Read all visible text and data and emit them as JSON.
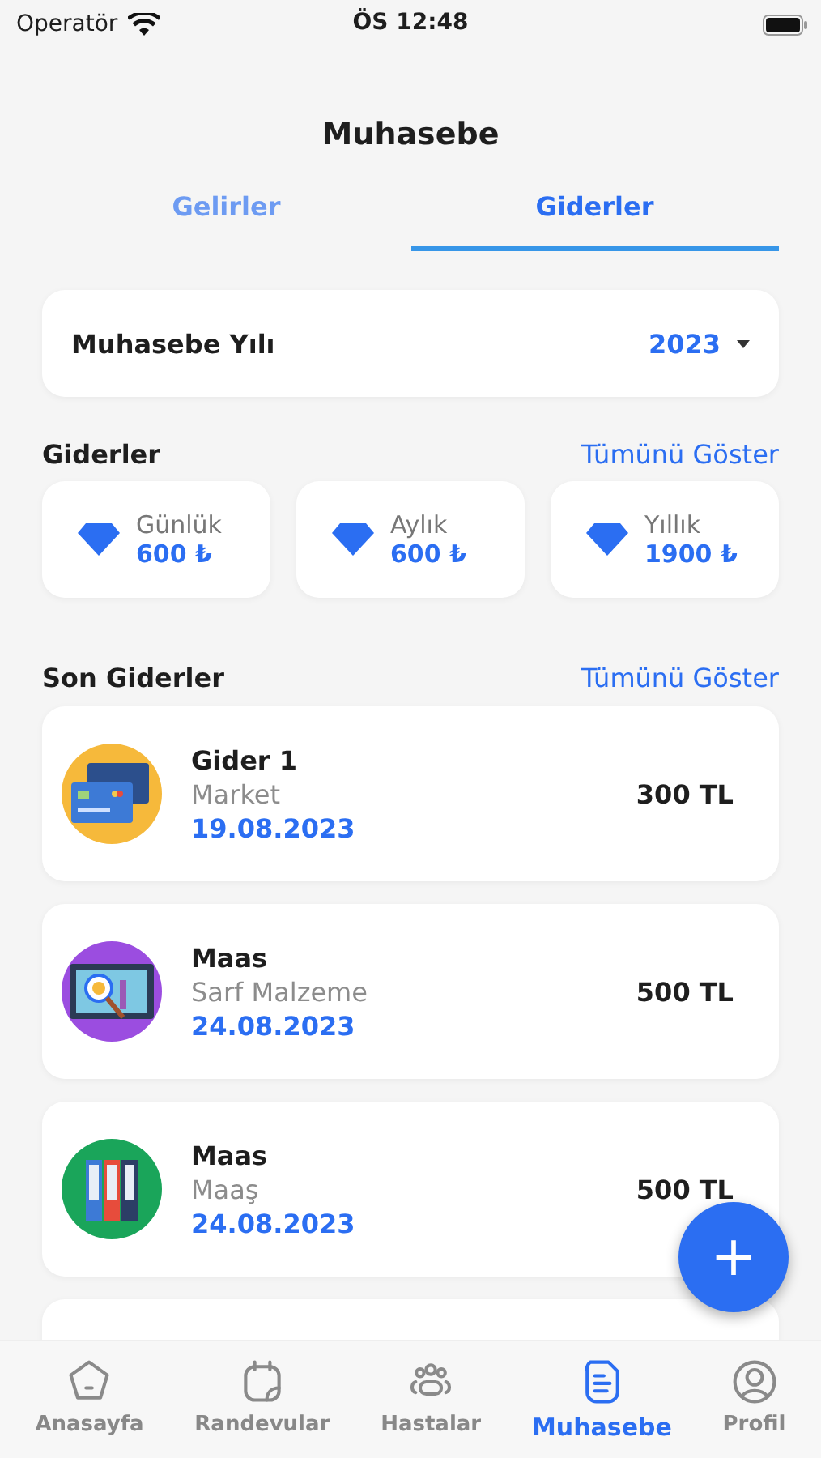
{
  "status_bar": {
    "carrier": "Operatör",
    "time": "ÖS 12:48"
  },
  "title": "Muhasebe",
  "tabs": [
    {
      "label": "Gelirler",
      "selected": false
    },
    {
      "label": "Giderler",
      "selected": true
    }
  ],
  "year_picker": {
    "label": "Muhasebe Yılı",
    "value": "2023"
  },
  "summary": {
    "title": "Giderler",
    "link": "Tümünü Göster",
    "stats": [
      {
        "label": "Günlük",
        "value": "600 ₺"
      },
      {
        "label": "Aylık",
        "value": "600 ₺"
      },
      {
        "label": "Yıllık",
        "value": "1900 ₺"
      }
    ]
  },
  "recent": {
    "title": "Son Giderler",
    "link": "Tümünü Göster",
    "items": [
      {
        "kind": "cards",
        "color": "#f6b93b",
        "name": "Gider 1",
        "category": "Market",
        "date": "19.08.2023",
        "amount": "300 TL"
      },
      {
        "kind": "laptop",
        "color": "#9b4de0",
        "name": "Maas",
        "category": "Sarf Malzeme",
        "date": "24.08.2023",
        "amount": "500 TL"
      },
      {
        "kind": "binders",
        "color": "#1aa55a",
        "name": "Maas",
        "category": "Maaş",
        "date": "24.08.2023",
        "amount": "500 TL"
      }
    ]
  },
  "fab": {
    "symbol": "+"
  },
  "nav": [
    {
      "kind": "home",
      "label": "Anasayfa",
      "selected": false
    },
    {
      "kind": "calendar",
      "label": "Randevular",
      "selected": false
    },
    {
      "kind": "people",
      "label": "Hastalar",
      "selected": false
    },
    {
      "kind": "document",
      "label": "Muhasebe",
      "selected": true
    },
    {
      "kind": "profile",
      "label": "Profil",
      "selected": false
    }
  ]
}
